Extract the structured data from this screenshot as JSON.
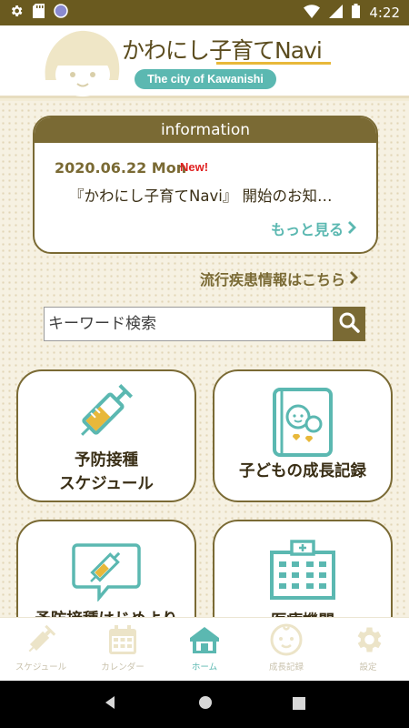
{
  "status_bar": {
    "time": "4:22"
  },
  "header": {
    "title": "かわにし子育てNavi",
    "subtitle": "The city of Kawanishi"
  },
  "info": {
    "heading": "information",
    "date": "2020.06.22 Mon",
    "badge": "New!",
    "title": "『かわにし子育てNavi』 開始のお知…",
    "more": "もっと見る"
  },
  "disease_link": "流行疾患情報はこちら",
  "search": {
    "placeholder": "キーワード検索"
  },
  "tiles": [
    {
      "line1": "予防接種",
      "line2": "スケジュール"
    },
    {
      "label": "子どもの成長記録"
    },
    {
      "label": "予防接種はじめより"
    },
    {
      "label": "医療機関"
    }
  ],
  "bottom_nav": [
    {
      "label": "スケジュール",
      "icon": "syringe-icon"
    },
    {
      "label": "カレンダー",
      "icon": "calendar-icon"
    },
    {
      "label": "ホーム",
      "icon": "home-icon",
      "active": true
    },
    {
      "label": "成長記録",
      "icon": "baby-face-icon"
    },
    {
      "label": "設定",
      "icon": "gear-icon"
    }
  ],
  "colors": {
    "brand_brown": "#7a6a34",
    "accent_teal": "#5bb8b1",
    "accent_yellow": "#e8b83a",
    "new_red": "#e02020"
  }
}
